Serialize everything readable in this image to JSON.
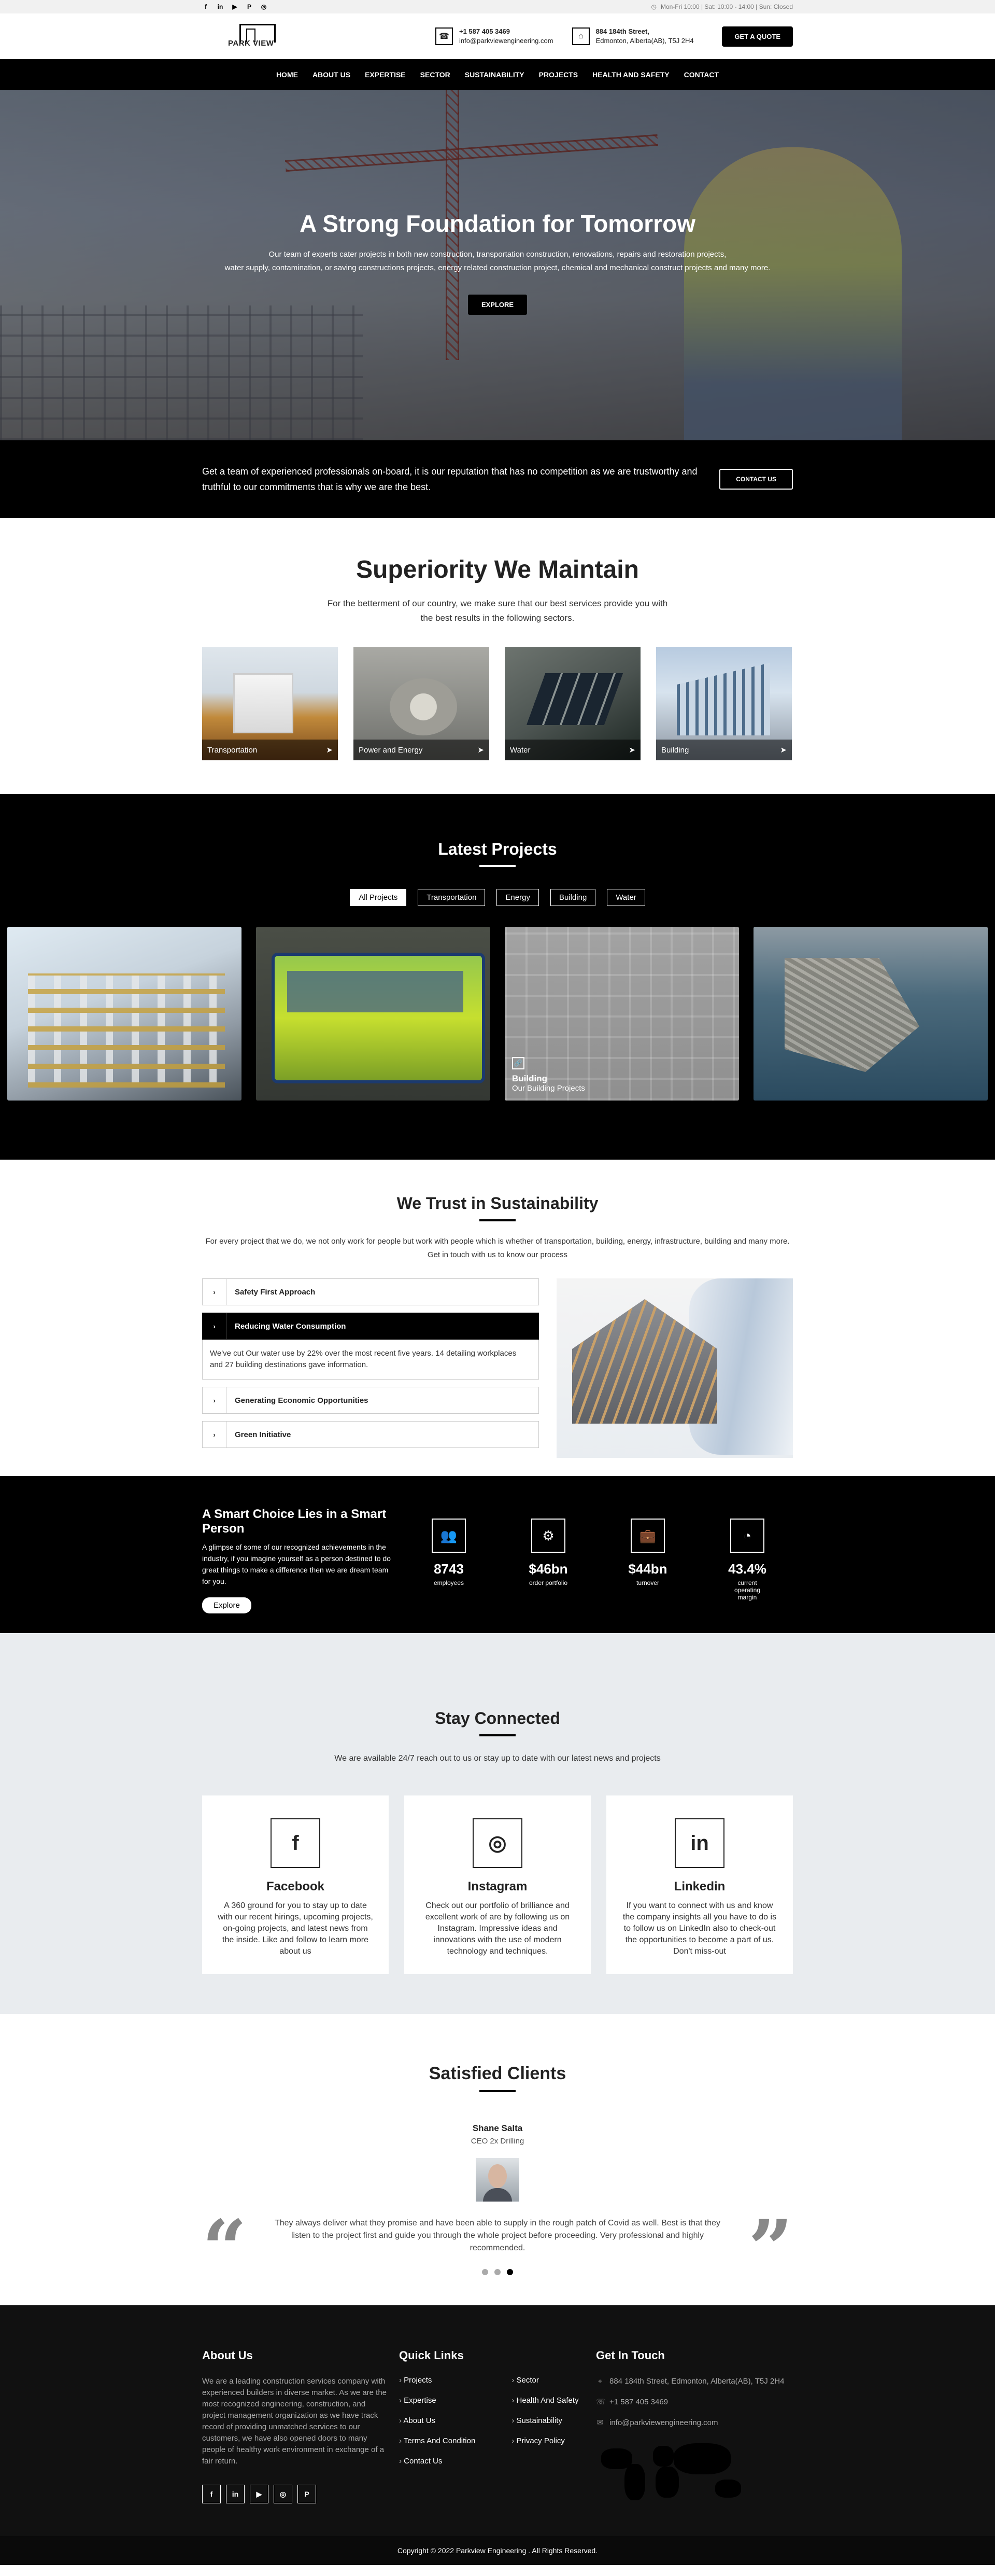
{
  "topbar": {
    "social": [
      {
        "icon": "facebook-icon",
        "glyph": "f"
      },
      {
        "icon": "linkedin-icon",
        "glyph": "in"
      },
      {
        "icon": "youtube-icon",
        "glyph": "▶"
      },
      {
        "icon": "pinterest-icon",
        "glyph": "P"
      },
      {
        "icon": "instagram-icon",
        "glyph": "◎"
      }
    ],
    "hours": "Mon-Fri 10:00 | Sat: 10:00 - 14:00 | Sun: Closed"
  },
  "header": {
    "logo_text": "PARK VIEW",
    "phone": "+1 587 405 3469",
    "email": "info@parkviewengineering.com",
    "address_line1": "884 184th Street,",
    "address_line2": "Edmonton, Alberta(AB), T5J 2H4",
    "quote_button": "GET A QUOTE"
  },
  "nav": [
    "HOME",
    "ABOUT US",
    "EXPERTISE",
    "SECTOR",
    "SUSTAINABILITY",
    "PROJECTS",
    "HEALTH AND SAFETY",
    "CONTACT"
  ],
  "hero": {
    "title": "A Strong Foundation for Tomorrow",
    "line1": "Our team of experts cater projects in both new construction, transportation construction, renovations, repairs and restoration projects,",
    "line2": "water supply, contamination, or saving constructions projects, energy related construction project, chemical and mechanical construct projects and many more.",
    "button": "EXPLORE"
  },
  "cta": {
    "text": "Get a team of experienced professionals on-board, it is our reputation that has no competition as we are trustworthy and truthful to our commitments that is why we are the best.",
    "button": "CONTACT US"
  },
  "superiority": {
    "title": "Superiority We Maintain",
    "lead": "For the betterment of our country, we make sure that our best services provide you with the best results in the following sectors.",
    "sectors": [
      "Transportation",
      "Power and Energy",
      "Water",
      "Building"
    ]
  },
  "projects": {
    "title": "Latest Projects",
    "filters": [
      "All Projects",
      "Transportation",
      "Energy",
      "Building",
      "Water"
    ],
    "active_filter": "All Projects",
    "hover_card": {
      "title": "Building",
      "subtitle": "Our Building Projects"
    }
  },
  "sustainability": {
    "title": "We Trust in Sustainability",
    "lead": "For every project that we do, we not only work for people but work with people which is whether of transportation, building, energy, infrastructure, building and many more. Get in touch with us to know our process",
    "items": [
      "Safety First Approach",
      "Reducing Water Consumption",
      "Generating Economic Opportunities",
      "Green Initiative"
    ],
    "open_text": "We've cut Our water use by 22% over the most recent five years. 14 detailing workplaces and 27 building destinations gave information."
  },
  "smart": {
    "title": "A Smart Choice Lies in a Smart Person",
    "text": "A glimpse of some of our recognized achievements in the industry, if you imagine yourself as a person destined to do great things to make a difference then we are dream team for you.",
    "button": "Explore",
    "stats": [
      {
        "value": "8743",
        "label": "employees",
        "icon": "team-icon",
        "glyph": "👥"
      },
      {
        "value": "$46bn",
        "label": "order portfolio",
        "icon": "gear-icon",
        "glyph": "⚙"
      },
      {
        "value": "$44bn",
        "label": "turnover",
        "icon": "briefcase-icon",
        "glyph": "💼"
      },
      {
        "value": "43.4%",
        "label": "current operating margin",
        "icon": "chart-icon",
        "glyph": "◔"
      }
    ]
  },
  "stay": {
    "title": "Stay Connected",
    "lead": "We are available 24/7 reach out to us or stay up to date with our latest news and projects",
    "cards": [
      {
        "name": "Facebook",
        "icon": "facebook-icon",
        "glyph": "f",
        "text": "A 360 ground for you to stay up to date with our recent hirings, upcoming projects, on-going projects, and latest news from the inside. Like and follow to learn more about us"
      },
      {
        "name": "Instagram",
        "icon": "instagram-icon",
        "glyph": "◎",
        "text": "Check out our portfolio of brilliance and excellent work of are by following us on Instagram. Impressive ideas and innovations with the use of modern technology and techniques."
      },
      {
        "name": "Linkedin",
        "icon": "linkedin-icon",
        "glyph": "in",
        "text": "If you want to connect with us and know the company insights all you have to do is to follow us on LinkedIn also to check-out the opportunities to become a part of us. Don't miss-out"
      }
    ]
  },
  "clients": {
    "title": "Satisfied Clients",
    "name": "Shane Salta",
    "role": "CEO 2x Drilling",
    "quote": "They always deliver what they promise and have been able to supply in the rough patch of Covid as well. Best is that they listen to the project first and guide you through the whole project before proceeding. Very professional and highly recommended."
  },
  "footer": {
    "about_title": "About Us",
    "about_text": "We are a leading construction services company with experienced builders in diverse market. As we are the most recognized engineering, construction, and project management organization as we have track record of providing unmatched services to our customers, we have also opened doors to many people of healthy work environment in exchange of a fair return.",
    "links_title": "Quick Links",
    "links_col1": [
      "Projects",
      "Expertise",
      "About Us",
      "Terms And Condition",
      "Contact Us"
    ],
    "links_col2": [
      "Sector",
      "Health And Safety",
      "Sustainability",
      "Privacy Policy"
    ],
    "contact_title": "Get In Touch",
    "contact_address": "884 184th Street, Edmonton, Alberta(AB), T5J 2H4",
    "contact_phone": "+1 587 405 3469",
    "contact_email": "info@parkviewengineering.com",
    "copyright": "Copyright © 2022 Parkview Engineering . All Rights Reserved."
  }
}
